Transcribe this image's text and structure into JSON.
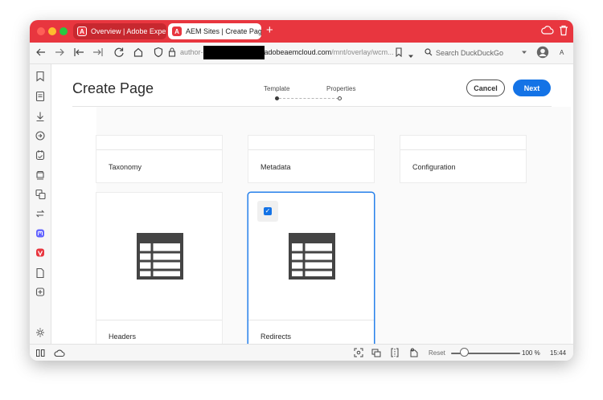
{
  "browser": {
    "tabs": [
      {
        "label": "Overview | Adobe Experie",
        "logo": "A"
      },
      {
        "label": "AEM Sites | Create Page",
        "logo": "A"
      }
    ],
    "new_tab": "+",
    "url": {
      "prefix": "author-",
      "host": "adobeaemcloud.com",
      "path": "/mnt/overlay/wcm..."
    },
    "search_placeholder": "Search DuckDuckGo",
    "reader_label": "A"
  },
  "page": {
    "title": "Create Page",
    "steps": [
      {
        "label": "Template",
        "active": true
      },
      {
        "label": "Properties",
        "active": false
      }
    ],
    "cancel_label": "Cancel",
    "next_label": "Next"
  },
  "templates": [
    {
      "name": "Taxonomy",
      "selected": false
    },
    {
      "name": "Metadata",
      "selected": false
    },
    {
      "name": "Configuration",
      "selected": false
    },
    {
      "name": "Headers",
      "selected": false,
      "icon": "table-icon"
    },
    {
      "name": "Redirects",
      "selected": true,
      "icon": "table-icon"
    }
  ],
  "statusbar": {
    "reset_label": "Reset",
    "zoom_level": "100 %",
    "time": "15:44"
  },
  "colors": {
    "titlebar": "#e8363f",
    "accent": "#1473e6",
    "selected_border": "#2680eb"
  }
}
